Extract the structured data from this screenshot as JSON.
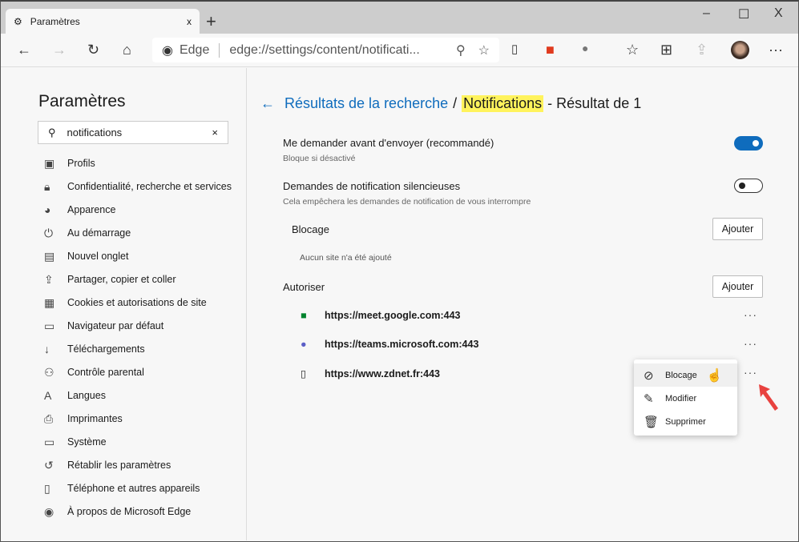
{
  "browser": {
    "tab_title": "Paramètres",
    "tab_close": "x",
    "new_tab": "+",
    "minimize": "–",
    "maximize": "☐",
    "close": "X",
    "site_label": "Edge",
    "url": "edge://settings/content/notificati...",
    "more": "···"
  },
  "sidebar": {
    "title": "Paramètres",
    "search_value": "notifications",
    "search_clear": "×",
    "items": [
      {
        "icon": "profile-icon",
        "glyph": "▣",
        "label": "Profils"
      },
      {
        "icon": "lock-icon",
        "glyph": "🔒︎",
        "label": "Confidentialité, recherche et services"
      },
      {
        "icon": "palette-icon",
        "glyph": "◕",
        "label": "Apparence"
      },
      {
        "icon": "power-icon",
        "glyph": "⏻",
        "label": "Au démarrage"
      },
      {
        "icon": "new-tab-icon",
        "glyph": "▤",
        "label": "Nouvel onglet"
      },
      {
        "icon": "share-icon",
        "glyph": "⇪",
        "label": "Partager, copier et coller"
      },
      {
        "icon": "cookies-icon",
        "glyph": "▦",
        "label": "Cookies et autorisations de site"
      },
      {
        "icon": "browser-icon",
        "glyph": "▭",
        "label": "Navigateur par défaut"
      },
      {
        "icon": "download-icon",
        "glyph": "↓",
        "label": "Téléchargements"
      },
      {
        "icon": "family-icon",
        "glyph": "⚇",
        "label": "Contrôle parental"
      },
      {
        "icon": "language-icon",
        "glyph": "A",
        "label": "Langues"
      },
      {
        "icon": "printer-icon",
        "glyph": "⎙",
        "label": "Imprimantes"
      },
      {
        "icon": "system-icon",
        "glyph": "▭",
        "label": "Système"
      },
      {
        "icon": "reset-icon",
        "glyph": "↺",
        "label": "Rétablir les paramètres"
      },
      {
        "icon": "phone-icon",
        "glyph": "▯",
        "label": "Téléphone et autres appareils"
      },
      {
        "icon": "edge-icon",
        "glyph": "◉",
        "label": "À propos de Microsoft Edge"
      }
    ]
  },
  "main": {
    "breadcrumb_link": "Résultats de la recherche",
    "separator": "/",
    "highlight": "Notifications",
    "result_text": "- Résultat de 1",
    "ask": {
      "label": "Me demander avant d'envoyer (recommandé)",
      "desc": "Bloque si désactivé",
      "enabled": true
    },
    "quiet": {
      "label": "Demandes de notification silencieuses",
      "desc": "Cela empêchera les demandes de notification de vous interrompre",
      "enabled": false
    },
    "block": {
      "label": "Blocage",
      "add": "Ajouter",
      "empty": "Aucun site n'a été ajouté"
    },
    "allow": {
      "label": "Autoriser",
      "add": "Ajouter",
      "sites": [
        "https://meet.google.com:443",
        "https://teams.microsoft.com:443",
        "https://www.zdnet.fr:443"
      ]
    },
    "more": "···",
    "context_menu": [
      "Blocage",
      "Modifier",
      "Supprimer"
    ]
  },
  "colors": {
    "accent": "#0f6cbd",
    "highlight": "#fff35c",
    "arrow": "#e8423f"
  }
}
